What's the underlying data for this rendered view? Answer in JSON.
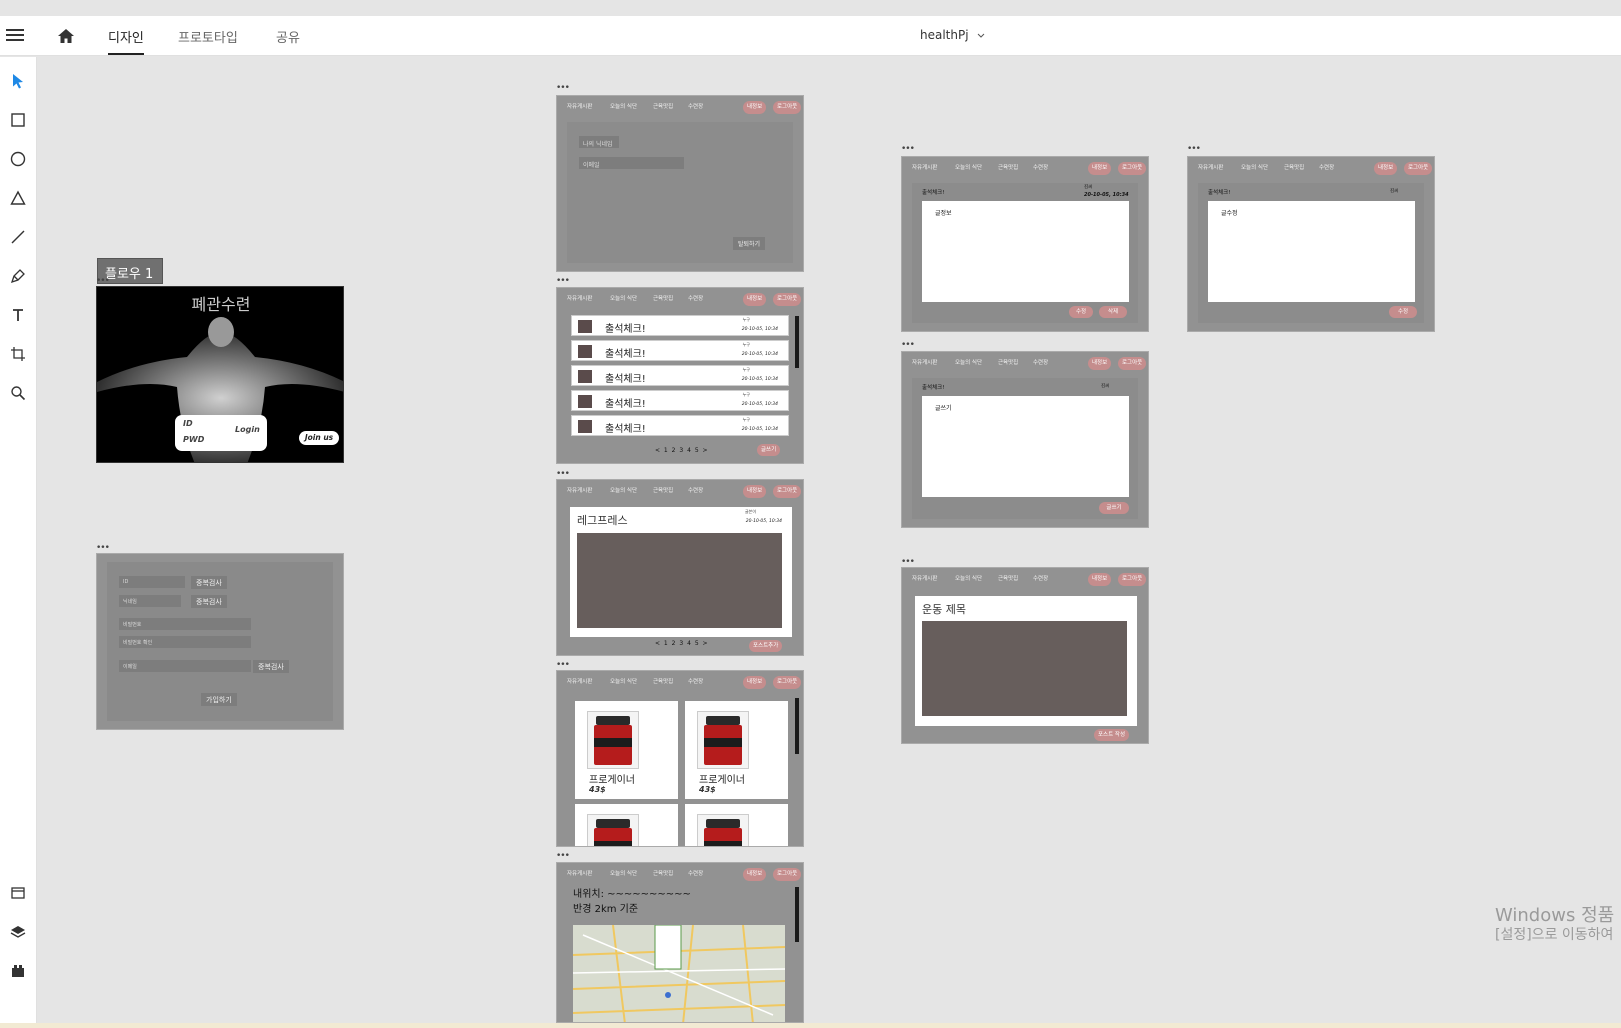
{
  "topbar": {
    "tabs": [
      "디자인",
      "프로토타입",
      "공유"
    ],
    "doc_title": "healthPj"
  },
  "flow_label": "플로우 1",
  "login_board": {
    "title": "폐관수련",
    "id_label": "ID",
    "pwd_label": "PWD",
    "login_label": "Login",
    "joinus_label": "Join us"
  },
  "signup_board": {
    "dup1": "중복검사",
    "dup2": "중복검사",
    "dup3": "중복검사",
    "submit": "가입하기",
    "field1": "ID",
    "field2": "닉네임",
    "field3": "비밀번호",
    "field4": "비밀번호 확인",
    "field5": "이메일"
  },
  "nav": {
    "items": [
      "자유게시판",
      "오늘의 식단",
      "근육맛집",
      "수련장"
    ],
    "myinfo": "내정보",
    "logout": "로그아웃"
  },
  "mypage_board": {
    "nickname": "나의 닉네임",
    "email": "이메일",
    "withdraw": "탈퇴하기"
  },
  "list_board": {
    "rows": [
      {
        "title": "출석체크!",
        "author": "누구",
        "date": "20-10-05, 10:34"
      },
      {
        "title": "출석체크!",
        "author": "누구",
        "date": "20-10-05, 10:34"
      },
      {
        "title": "출석체크!",
        "author": "누구",
        "date": "20-10-05, 10:34"
      },
      {
        "title": "출석체크!",
        "author": "누구",
        "date": "20-10-05, 10:34"
      },
      {
        "title": "출석체크!",
        "author": "누구",
        "date": "20-10-05, 10:34"
      }
    ],
    "pager": "< 1 2 3 4 5 >",
    "write": "글쓰기"
  },
  "diet_board": {
    "title": "레그프레스",
    "author": "글쓴이",
    "date": "20-10-05, 10:34",
    "pager": "< 1 2 3 4 5 >",
    "add_post": "포스트추가"
  },
  "shop_board": {
    "products": [
      {
        "name": "프로게이너",
        "price": "43$"
      },
      {
        "name": "프로게이너",
        "price": "43$"
      }
    ]
  },
  "map_board": {
    "line1": "내위치: ~~~~~~~~~~",
    "line2": "반경 2km 기준"
  },
  "detail_board": {
    "title": "출석체크!",
    "author": "김씨",
    "date": "20-10-05, 10:34",
    "body": "글정보",
    "edit": "수정",
    "delete": "삭제"
  },
  "edit_board": {
    "title": "출석체크!",
    "author": "김씨",
    "body": "글수정",
    "submit": "수정"
  },
  "write_board": {
    "title": "출석체크!",
    "author": "김씨",
    "body": "글쓰기",
    "submit": "글쓰기"
  },
  "workout_board": {
    "title": "운동 제목",
    "submit": "포스트 작성"
  },
  "watermark": {
    "line1": "Windows 정품",
    "line2": "[설정]으로 이동하여"
  }
}
